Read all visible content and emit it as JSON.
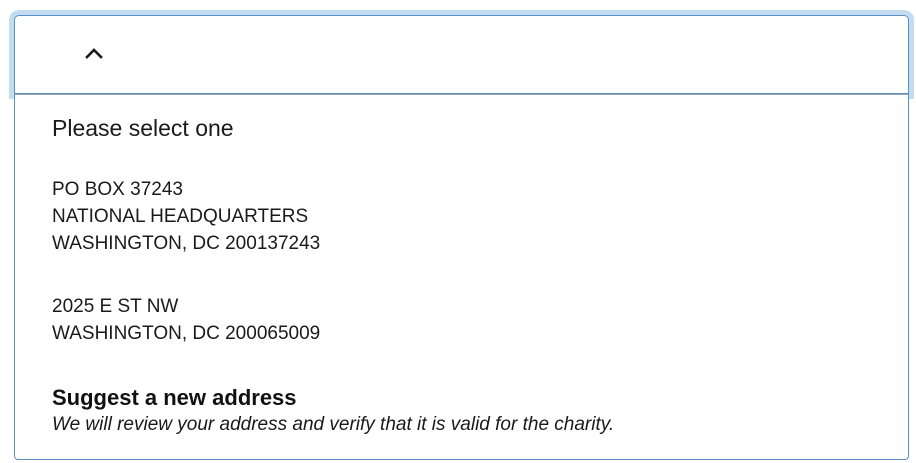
{
  "dropdown": {
    "toggle_icon": "chevron-up-icon",
    "accent_color": "#5b8ec4",
    "focus_ring_color": "#c2dcf2"
  },
  "list": {
    "placeholder": "Please select one",
    "options": [
      {
        "lines": [
          "PO BOX 37243",
          "NATIONAL HEADQUARTERS",
          "WASHINGTON, DC 200137243"
        ]
      },
      {
        "lines": [
          "2025 E ST NW",
          "WASHINGTON, DC 200065009"
        ]
      }
    ],
    "suggest": {
      "title": "Suggest a new address",
      "description": "We will review your address and verify that it is valid for the charity."
    }
  }
}
